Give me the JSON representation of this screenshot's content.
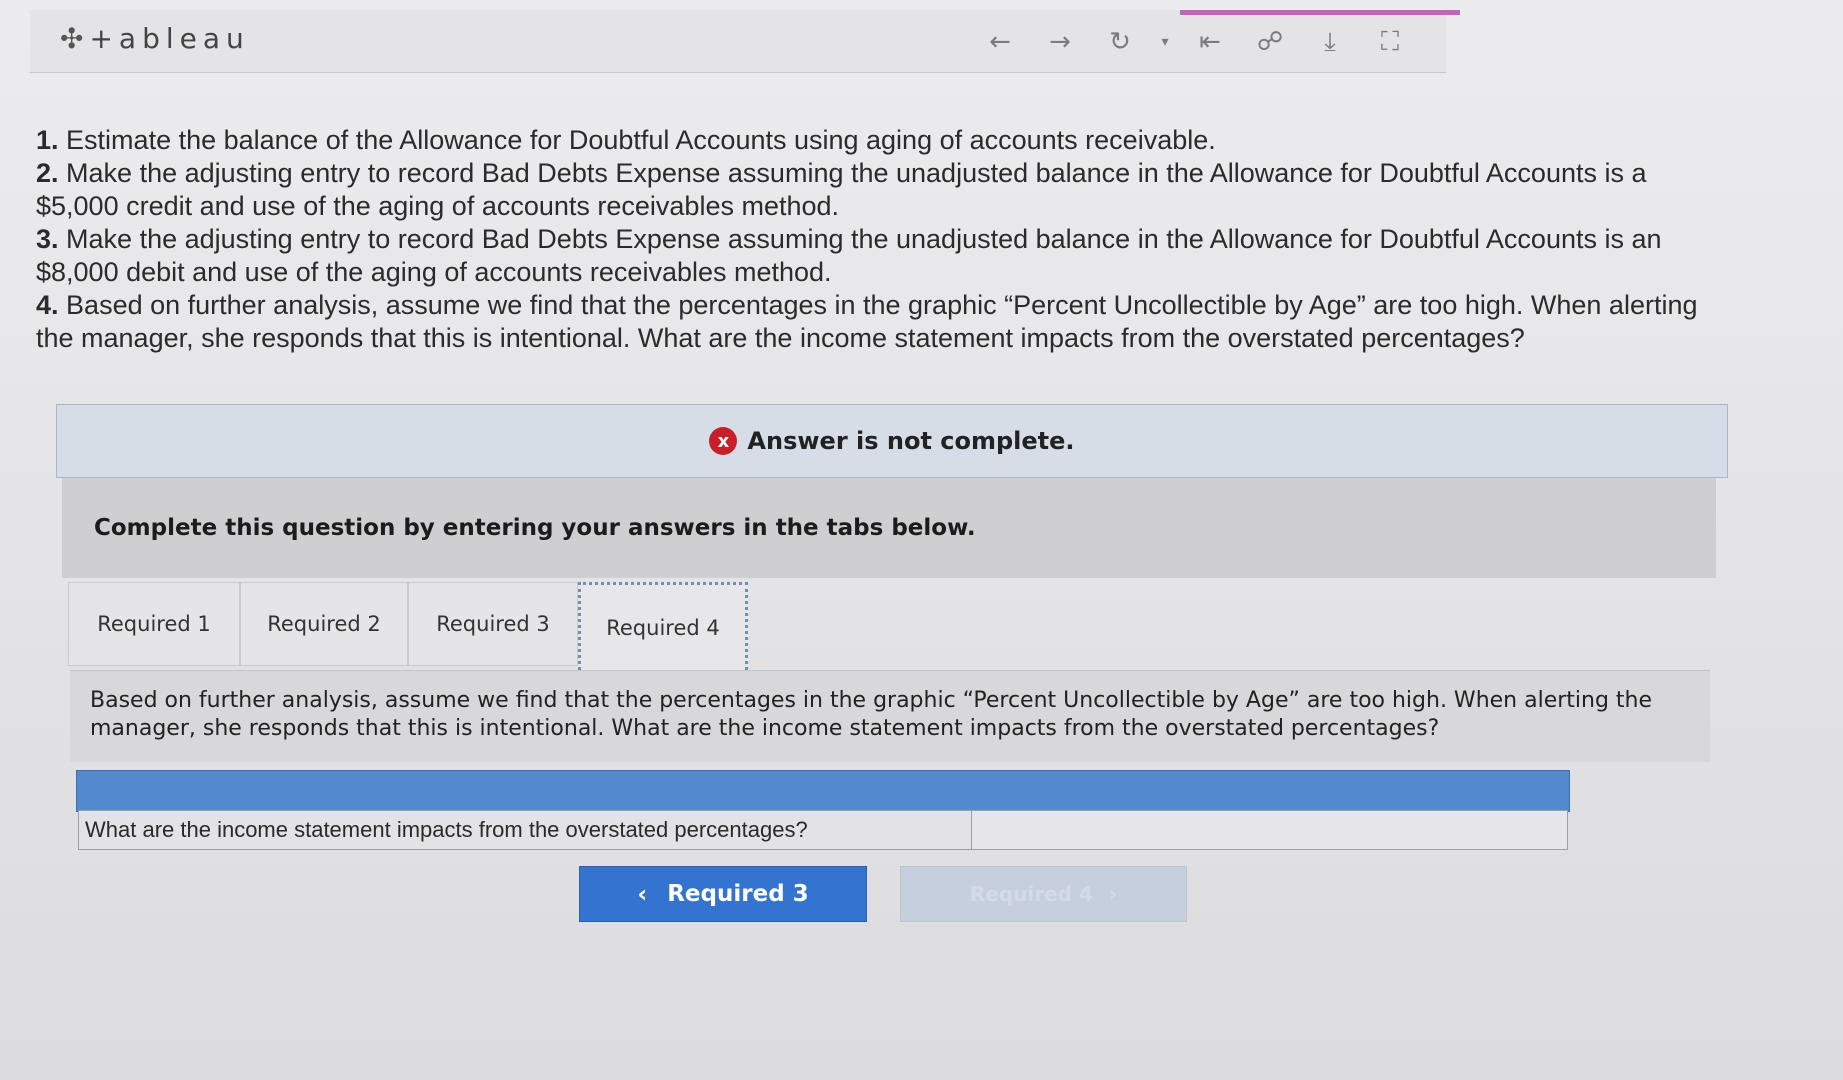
{
  "toolbar": {
    "logo_text": "+ableau",
    "icons": [
      "back-arrow-icon",
      "forward-arrow-icon",
      "redo-icon",
      "dropdown-caret-icon",
      "revert-icon",
      "share-icon",
      "download-icon",
      "fullscreen-icon"
    ]
  },
  "questions": [
    {
      "num": "1.",
      "text": "Estimate the balance of the Allowance for Doubtful Accounts using aging of accounts receivable."
    },
    {
      "num": "2.",
      "text": "Make the adjusting entry to record Bad Debts Expense assuming the unadjusted balance in the Allowance for Doubtful Accounts is a $5,000 credit and use of the aging of accounts receivables method."
    },
    {
      "num": "3.",
      "text": "Make the adjusting entry to record Bad Debts Expense assuming the unadjusted balance in the Allowance for Doubtful Accounts is an $8,000 debit and use of the aging of accounts receivables method."
    },
    {
      "num": "4.",
      "text": "Based on further analysis, assume we find that the percentages in the graphic “Percent Uncollectible by Age” are too high. When alerting the manager, she responds that this is intentional. What are the income statement impacts from the overstated percentages?"
    }
  ],
  "banner": {
    "status_icon": "x",
    "status_text": "Answer is not complete."
  },
  "instructions": "Complete this question by entering your answers in the tabs below.",
  "tabs": [
    {
      "label": "Required 1"
    },
    {
      "label": "Required 2"
    },
    {
      "label": "Required 3"
    },
    {
      "label": "Required 4"
    }
  ],
  "active_tab": "Required 4",
  "tab_content": "Based on further analysis, assume we find that the percentages in the graphic “Percent Uncollectible by Age” are too high. When alerting the manager, she responds that this is intentional. What are the income statement impacts from the overstated percentages?",
  "table": {
    "question": "What are the income statement impacts from the overstated percentages?",
    "answer": ""
  },
  "nav": {
    "prev_label": "Required 3",
    "next_label": "Required 4"
  },
  "colors": {
    "accent_blue": "#3473cf",
    "header_blue": "#5289cf",
    "error_red": "#c8202a",
    "toolbar_accent": "#b96bb8"
  }
}
